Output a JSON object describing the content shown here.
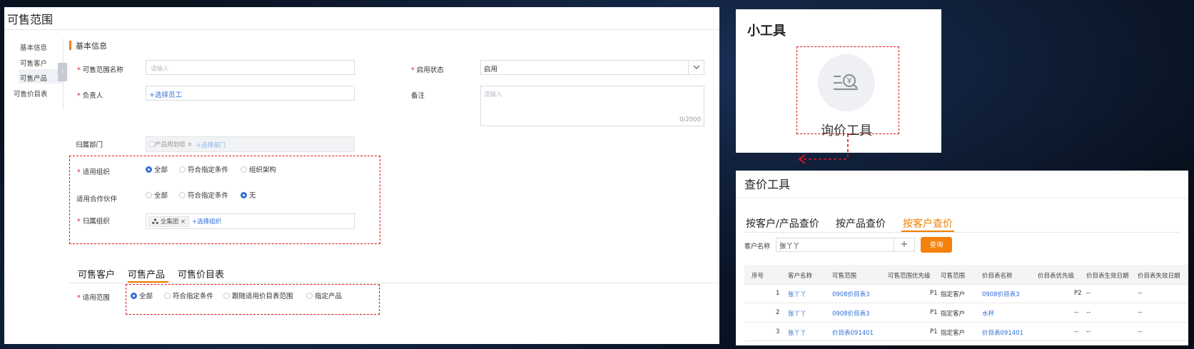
{
  "left": {
    "title": "可售范围",
    "side_nav": [
      "基本信息",
      "可售客户",
      "可售产品",
      "可售价目表"
    ],
    "collapse_icon": "‹",
    "section_title": "基本信息",
    "req_mark": "*",
    "fields": {
      "name_label": "可售范围名称",
      "name_placeholder": "请输入",
      "status_label": "启用状态",
      "status_value": "启用",
      "owner_label": "负责人",
      "owner_link": "+选择员工",
      "remark_label": "备注",
      "remark_placeholder": "请输入",
      "remark_count": "0/2000",
      "dept_label": "归属部门",
      "dept_tag": "产品规划组",
      "dept_tag_close": "×",
      "dept_link": "+选择部门",
      "org_label": "适用组织",
      "org_options": [
        "全部",
        "符合指定条件",
        "组织架构"
      ],
      "partner_label": "适用合作伙伴",
      "partner_options": [
        "全部",
        "符合指定条件",
        "无"
      ],
      "home_org_label": "归属组织",
      "home_org_tag": "全集团",
      "home_org_tag_close": "×",
      "home_org_link": "+选择组织"
    },
    "tabs": [
      "可售客户",
      "可售产品",
      "可售价目表"
    ],
    "scope_label": "适用范围",
    "scope_options": [
      "全部",
      "符合指定条件",
      "跟随适用价目表范围",
      "指定产品"
    ],
    "accent_color": "#f08000",
    "link_color": "#2f6fd6",
    "highlight_color": "#e0141e"
  },
  "widget": {
    "title": "小工具",
    "tool_icon": "price-inquiry-icon",
    "tool_label": "询价工具"
  },
  "query": {
    "title": "查价工具",
    "tabs": [
      "按客户/产品查价",
      "按产品查价",
      "按客户查价"
    ],
    "customer_label": "客户名称",
    "customer_value": "张丫丫",
    "add_icon": "+",
    "query_button": "查询",
    "table": {
      "headers": [
        "序号",
        "客户名称",
        "可售范围",
        "可售范围优先级",
        "可售范围",
        "价目表名称",
        "价目表优先级",
        "价目表生效日期",
        "价目表失效日期"
      ],
      "rows": [
        [
          "1",
          "张丫丫",
          "0908价目表3",
          "P1",
          "指定客户",
          "0908价目表3",
          "P2",
          "--",
          "--"
        ],
        [
          "2",
          "张丫丫",
          "0908价目表3",
          "P1",
          "指定客户",
          "水杯",
          "--",
          "--",
          "--"
        ],
        [
          "3",
          "张丫丫",
          "价目表091401",
          "P1",
          "指定客户",
          "价目表091401",
          "--",
          "--",
          "--"
        ]
      ]
    }
  }
}
